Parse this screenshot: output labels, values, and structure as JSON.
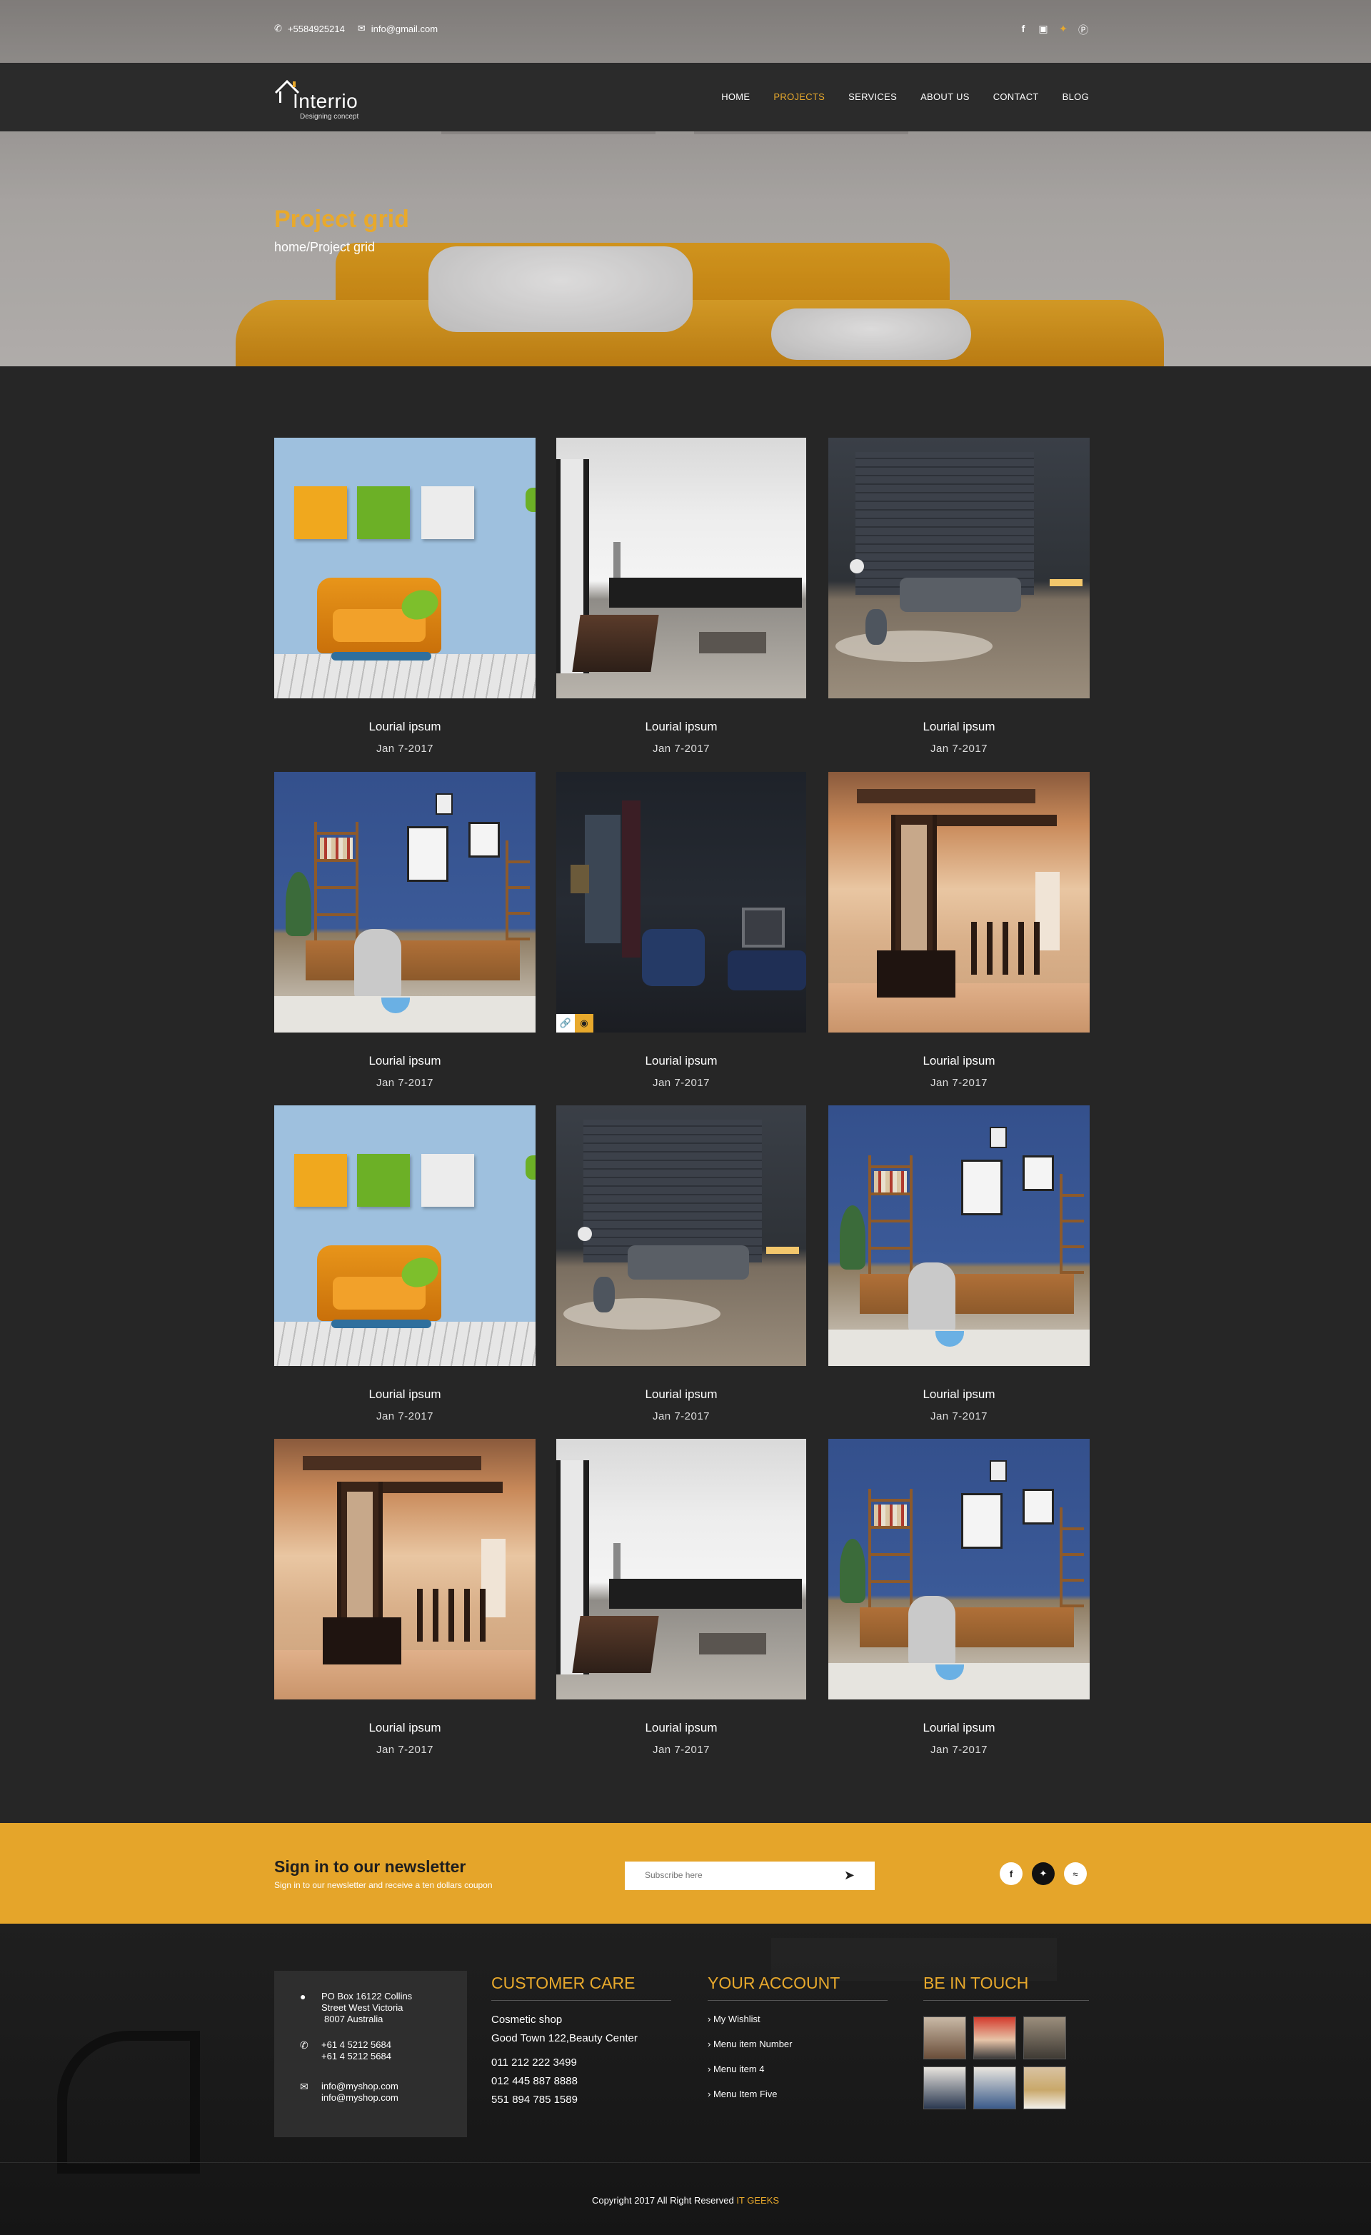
{
  "topbar": {
    "phone": "+5584925214",
    "email": "info@gmail.com",
    "phone_icon": "phone-icon",
    "email_icon": "envelope-icon",
    "social": [
      "facebook-icon",
      "instagram-icon",
      "twitter-icon",
      "pinterest-icon"
    ]
  },
  "nav": {
    "logo_name": "Interrio",
    "logo_tagline": "Designing concept",
    "items": [
      {
        "label": "HOME",
        "active": false
      },
      {
        "label": "PROJECTS",
        "active": true
      },
      {
        "label": "SERVICES",
        "active": false
      },
      {
        "label": "ABOUT US",
        "active": false
      },
      {
        "label": "CONTACT",
        "active": false
      },
      {
        "label": "BLOG",
        "active": false
      }
    ]
  },
  "hero": {
    "title": "Project grid",
    "breadcrumb": "home/Project grid"
  },
  "projects": [
    {
      "title": "Lourial ipsum",
      "date": "Jan 7-2017",
      "image": "blue-room"
    },
    {
      "title": "Lourial ipsum",
      "date": "Jan 7-2017",
      "image": "white-room"
    },
    {
      "title": "Lourial ipsum",
      "date": "Jan 7-2017",
      "image": "dark-room"
    },
    {
      "title": "Lourial ipsum",
      "date": "Jan 7-2017",
      "image": "office-room"
    },
    {
      "title": "Lourial ipsum",
      "date": "Jan 7-2017",
      "image": "night-room"
    },
    {
      "title": "Lourial ipsum",
      "date": "Jan 7-2017",
      "image": "warm-room"
    },
    {
      "title": "Lourial ipsum",
      "date": "Jan 7-2017",
      "image": "blue-room"
    },
    {
      "title": "Lourial ipsum",
      "date": "Jan 7-2017",
      "image": "dark-room"
    },
    {
      "title": "Lourial ipsum",
      "date": "Jan 7-2017",
      "image": "office-room"
    },
    {
      "title": "Lourial ipsum",
      "date": "Jan 7-2017",
      "image": "warm-room"
    },
    {
      "title": "Lourial ipsum",
      "date": "Jan 7-2017",
      "image": "white-room"
    },
    {
      "title": "Lourial ipsum",
      "date": "Jan 7-2017",
      "image": "office-room"
    }
  ],
  "hover_icons": {
    "link": "link-icon",
    "view": "eye-icon"
  },
  "newsletter": {
    "heading": "Sign in to our newsletter",
    "subtext": "Sign in to our newsletter and receive a ten  dollars coupon",
    "placeholder": "Subscribe here",
    "send_icon": "paper-plane-icon",
    "social": [
      "facebook-icon",
      "twitter-icon",
      "wifi-icon"
    ]
  },
  "footer": {
    "address": {
      "lines": [
        "PO Box 16122 Collins",
        "Street West Victoria",
        "8007 Australia"
      ],
      "phones": [
        "+61 4 5212 5684",
        "+61 4 5212 5684"
      ],
      "emails": [
        "info@myshop.com",
        "info@myshop.com"
      ]
    },
    "customer_care": {
      "heading": "CUSTOMER CARE",
      "lines": [
        "Cosmetic shop",
        "Good Town 122,Beauty Center"
      ],
      "phones": [
        "011 212 222 3499",
        "012 445 887 8888",
        "551 894 785 1589"
      ]
    },
    "account": {
      "heading": "YOUR ACCOUNT",
      "links": [
        "My Wishlist",
        "Menu item Number",
        "Menu item 4",
        "Menu Item Five"
      ]
    },
    "touch": {
      "heading": "BE IN TOUCH"
    },
    "copyright": "Copyright 2017  All Right Reserved",
    "brand": "IT GEEKS"
  },
  "colors": {
    "accent": "#e8a92c",
    "background": "#262626",
    "newsletter": "#e5a52a"
  }
}
